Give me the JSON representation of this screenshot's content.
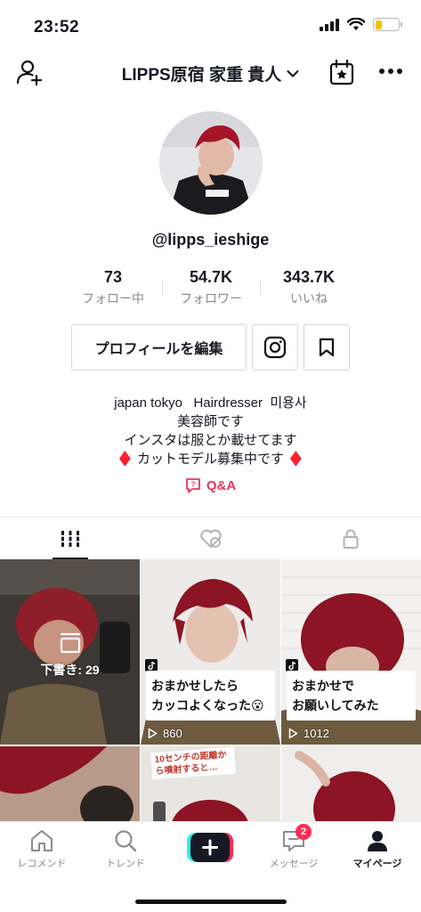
{
  "status_bar": {
    "time": "23:52",
    "battery_level": 0.3
  },
  "header": {
    "title": "LIPPS原宿 家重 貴人"
  },
  "profile": {
    "username": "@lipps_ieshige",
    "stats": [
      {
        "value": "73",
        "label": "フォロー中"
      },
      {
        "value": "54.7K",
        "label": "フォロワー"
      },
      {
        "value": "343.7K",
        "label": "いいね"
      }
    ],
    "edit_button": "プロフィールを編集",
    "bio": [
      "japan tokyo   Hairdresser  미용사",
      "美容師です",
      "インスタは服とか載せてます",
      "♦️ カットモデル募集中です ♦️"
    ],
    "qa_label": "Q&A"
  },
  "videos": [
    {
      "type": "draft",
      "draft_label": "下書き: 29"
    },
    {
      "type": "video",
      "caption_lines": [
        "おまかせしたら",
        "カッコよくなった😮"
      ],
      "views": "860"
    },
    {
      "type": "video",
      "caption_lines": [
        "おまかせで",
        "お願いしてみた"
      ],
      "views": "1012"
    },
    {
      "type": "video",
      "overlay_text": ""
    },
    {
      "type": "video",
      "overlay_text": "10センチの距離から噴射すると…"
    },
    {
      "type": "video",
      "overlay_text": ""
    }
  ],
  "bottom_nav": [
    {
      "label": "レコメンド",
      "icon": "home-icon"
    },
    {
      "label": "トレンド",
      "icon": "search-icon"
    },
    {
      "label": "",
      "icon": "plus-icon"
    },
    {
      "label": "メッセージ",
      "icon": "inbox-icon",
      "badge": "2"
    },
    {
      "label": "マイページ",
      "icon": "profile-icon"
    }
  ],
  "colors": {
    "accent": "#fe2c55",
    "qa": "#e8375a",
    "battery": "#f4c400"
  }
}
